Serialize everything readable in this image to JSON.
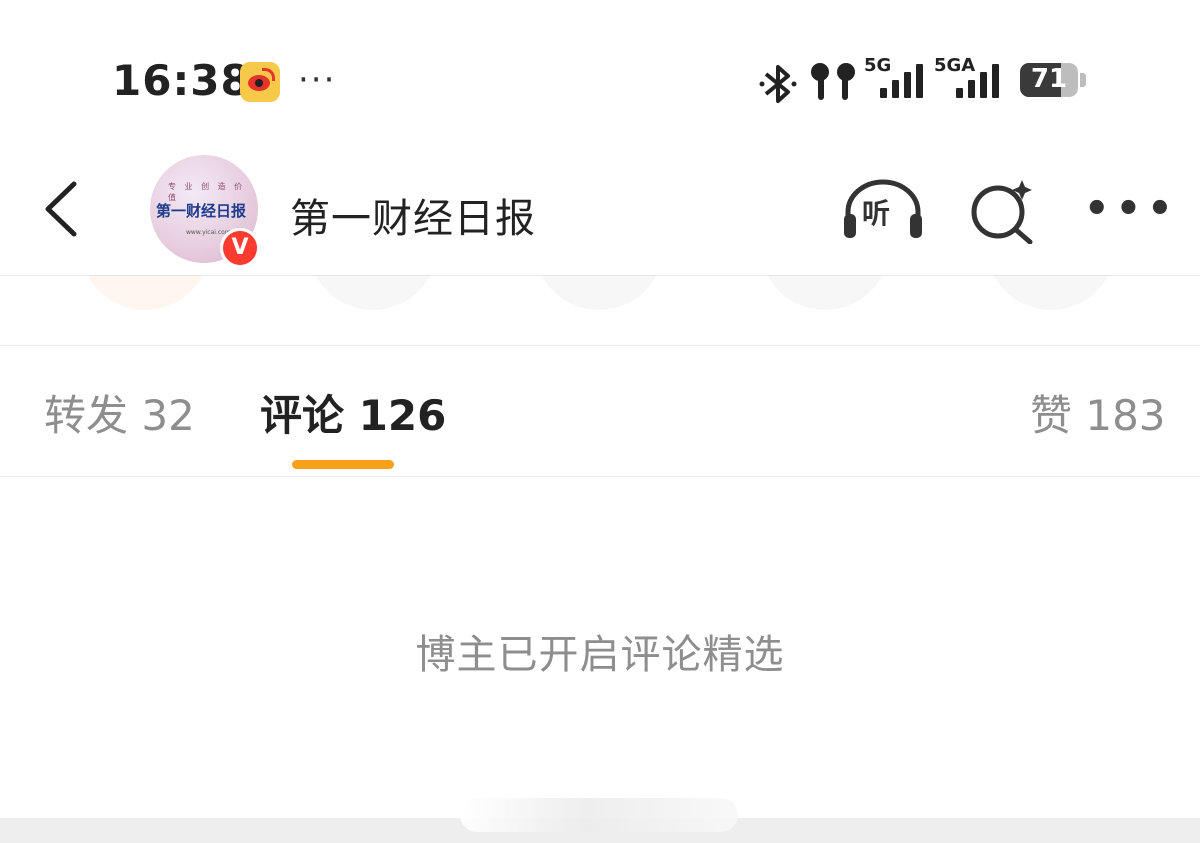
{
  "status_bar": {
    "time": "16:38",
    "more": "···",
    "net1_label": "5G",
    "net2_label": "5GA",
    "battery": "71",
    "battery_level": 0.71,
    "icons": [
      "weibo-app-icon",
      "bluetooth-icon",
      "earbuds-icon",
      "signal-icon",
      "battery-icon"
    ]
  },
  "header": {
    "account_name": "第一财经日报",
    "avatar_masthead": "第一财经日报",
    "avatar_tagline": "专 业 创 造 价 值",
    "avatar_url": "www.yicai.com",
    "verified_badge": "V",
    "listen_label": "听",
    "icons": [
      "back-icon",
      "listen-headphones-icon",
      "ai-search-icon",
      "more-icon"
    ]
  },
  "tabs": {
    "repost": "转发 32",
    "comment": "评论 126",
    "like": "赞 183",
    "active": "comment"
  },
  "comments": {
    "empty_message": "博主已开启评论精选"
  },
  "colors": {
    "accent": "#f7a11b",
    "verified": "#ff3b30",
    "muted_text": "#8e8e8e"
  }
}
